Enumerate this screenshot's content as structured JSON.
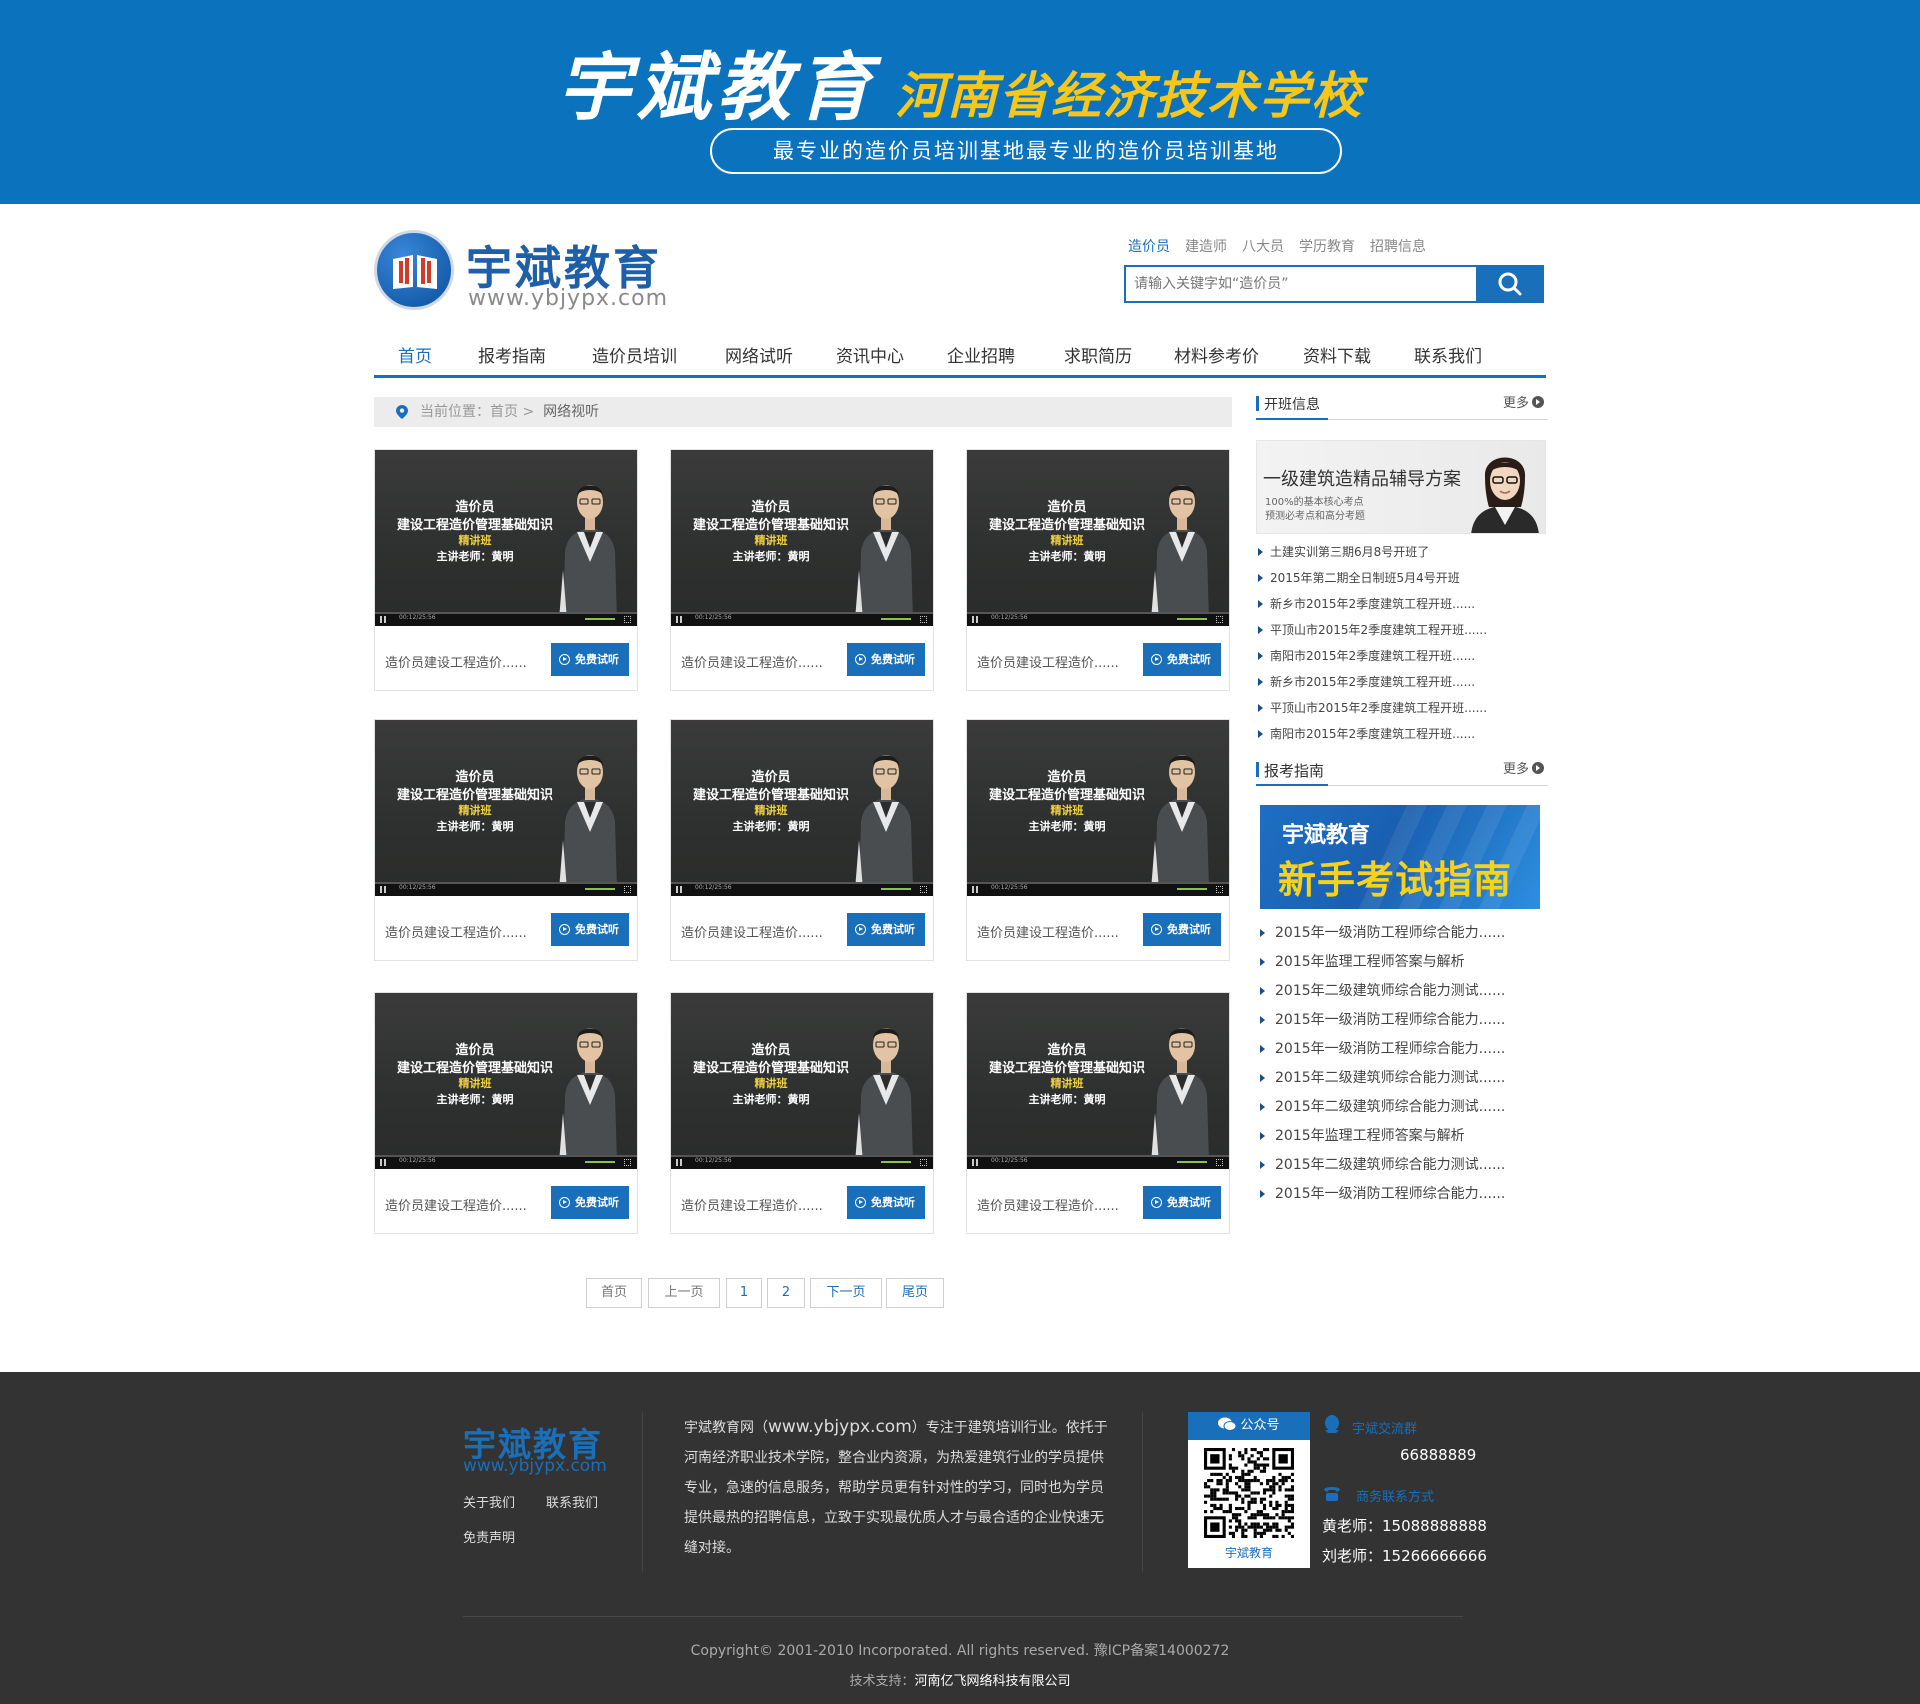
{
  "banner": {
    "title_main": "宇斌教育",
    "title_sub": "河南省经济技术学校",
    "slogan": "最专业的造价员培训基地最专业的造价员培训基地"
  },
  "logo": {
    "name": "宇斌教育",
    "url": "www.ybjypx.com"
  },
  "search": {
    "tabs": [
      "造价员",
      "建造师",
      "八大员",
      "学历教育",
      "招聘信息"
    ],
    "active_tab": "造价员",
    "placeholder": "请输入关键字如“造价员”"
  },
  "nav": {
    "items": [
      "首页",
      "报考指南",
      "造价员培训",
      "网络试听",
      "资讯中心",
      "企业招聘",
      "求职简历",
      "材料参考价",
      "资料下载",
      "联系我们"
    ],
    "active": "首页"
  },
  "breadcrumb": {
    "prefix": "当前位置：首页 >",
    "current": "网络视听"
  },
  "videos": [
    {
      "line1": "造价员",
      "line2": "建设工程造价管理基础知识",
      "line3": "精讲班",
      "line4": "主讲老师：黄明",
      "time": "00:12/25:56",
      "caption": "造价员建设工程造价......",
      "button": "免费试听"
    },
    {
      "line1": "造价员",
      "line2": "建设工程造价管理基础知识",
      "line3": "精讲班",
      "line4": "主讲老师：黄明",
      "time": "00:12/25:56",
      "caption": "造价员建设工程造价......",
      "button": "免费试听"
    },
    {
      "line1": "造价员",
      "line2": "建设工程造价管理基础知识",
      "line3": "精讲班",
      "line4": "主讲老师：黄明",
      "time": "00:12/25:56",
      "caption": "造价员建设工程造价......",
      "button": "免费试听"
    },
    {
      "line1": "造价员",
      "line2": "建设工程造价管理基础知识",
      "line3": "精讲班",
      "line4": "主讲老师：黄明",
      "time": "00:12/25:56",
      "caption": "造价员建设工程造价......",
      "button": "免费试听"
    },
    {
      "line1": "造价员",
      "line2": "建设工程造价管理基础知识",
      "line3": "精讲班",
      "line4": "主讲老师：黄明",
      "time": "00:12/25:56",
      "caption": "造价员建设工程造价......",
      "button": "免费试听"
    },
    {
      "line1": "造价员",
      "line2": "建设工程造价管理基础知识",
      "line3": "精讲班",
      "line4": "主讲老师：黄明",
      "time": "00:12/25:56",
      "caption": "造价员建设工程造价......",
      "button": "免费试听"
    },
    {
      "line1": "造价员",
      "line2": "建设工程造价管理基础知识",
      "line3": "精讲班",
      "line4": "主讲老师：黄明",
      "time": "00:12/25:56",
      "caption": "造价员建设工程造价......",
      "button": "免费试听"
    },
    {
      "line1": "造价员",
      "line2": "建设工程造价管理基础知识",
      "line3": "精讲班",
      "line4": "主讲老师：黄明",
      "time": "00:12/25:56",
      "caption": "造价员建设工程造价......",
      "button": "免费试听"
    },
    {
      "line1": "造价员",
      "line2": "建设工程造价管理基础知识",
      "line3": "精讲班",
      "line4": "主讲老师：黄明",
      "time": "00:12/25:56",
      "caption": "造价员建设工程造价......",
      "button": "免费试听"
    }
  ],
  "pagination": [
    "首页",
    "上一页",
    "1",
    "2",
    "下一页",
    "尾页"
  ],
  "sidebar": {
    "section1": {
      "title": "开班信息",
      "more": "更多",
      "promo_title": "一级建筑造精品辅导方案",
      "promo_sub1": "100%的基本核心考点",
      "promo_sub2": "预测必考点和高分考题",
      "items": [
        "土建实训第三期6月8号开班了",
        "2015年第二期全日制班5月4号开班",
        "新乡市2015年2季度建筑工程开班......",
        "平顶山市2015年2季度建筑工程开班......",
        "南阳市2015年2季度建筑工程开班......",
        "新乡市2015年2季度建筑工程开班......",
        "平顶山市2015年2季度建筑工程开班......",
        "南阳市2015年2季度建筑工程开班......"
      ]
    },
    "section2": {
      "title": "报考指南",
      "more": "更多",
      "promo_a": "宇斌教育",
      "promo_b": "新手考试指南",
      "items": [
        "2015年一级消防工程师综合能力......",
        "2015年监理工程师答案与解析",
        "2015年二级建筑师综合能力测试......",
        "2015年一级消防工程师综合能力......",
        "2015年一级消防工程师综合能力......",
        "2015年二级建筑师综合能力测试......",
        "2015年二级建筑师综合能力测试......",
        "2015年监理工程师答案与解析",
        "2015年二级建筑师综合能力测试......",
        "2015年一级消防工程师综合能力......"
      ]
    }
  },
  "footer": {
    "logo": "宇斌教育",
    "url": "www.ybjypx.com",
    "links": [
      "关于我们",
      "联系我们",
      "免责声明"
    ],
    "about_pre": "宇斌教育网（",
    "about_url": "www.ybjypx.com",
    "about_post": "）专注于建筑培训行业。依托于河南经济职业技术学院，整合业内资源，为热爱建筑行业的学员提供专业，急速的信息服务，帮助学员更有针对性的学习，同时也为学员提供最热的招聘信息，立致于实现最优质人才与最合适的企业快速无缝对接。",
    "qr_head": "公众号",
    "qr_caption": "宇斌教育",
    "group_label": "宇斌交流群",
    "group_number": "66888889",
    "contact_label": "商务联系方式",
    "contact1": "黄老师：15088888888",
    "contact2": "刘老师：15266666666",
    "copyright": "Copyright© 2001-2010 Incorporated. All rights reserved. 豫ICP备案14000272",
    "tech_label": "技术支持：",
    "tech_company": "河南亿飞网络科技有限公司"
  },
  "colors": {
    "brand_blue": "#0b72bd",
    "accent_yellow": "#f6c71a",
    "footer_bg": "#333333"
  }
}
